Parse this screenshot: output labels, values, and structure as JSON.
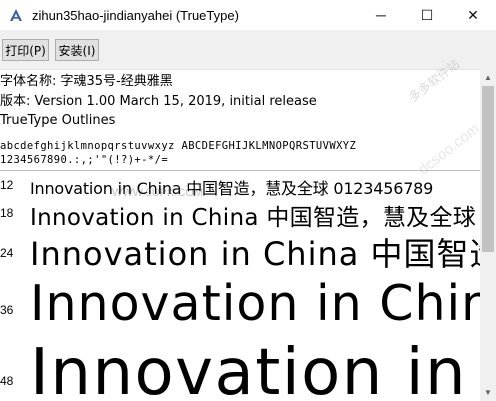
{
  "window": {
    "title": "zihun35hao-jindianyahei (TrueType)",
    "minimize_glyph": "─",
    "maximize_glyph": "☐",
    "close_glyph": "✕"
  },
  "toolbar": {
    "print_label": "打印(P)",
    "install_label": "安装(I)"
  },
  "font_info": {
    "name_line": "字体名称: 字魂35号-经典雅黑",
    "version_line": "版本: Version 1.00 March 15, 2019, initial release",
    "outline_line": "TrueType Outlines"
  },
  "charset": {
    "line1": "abcdefghijklmnopqrstuvwxyz ABCDEFGHIJKLMNOPQRSTUVWXYZ",
    "line2": "1234567890.:,;'\"(!?)+-*/="
  },
  "samples": [
    {
      "size": "12",
      "text": "Innovation in China 中国智造，慧及全球 0123456789"
    },
    {
      "size": "18",
      "text": "Innovation in China 中国智造，慧及全球"
    },
    {
      "size": "24",
      "text": "Innovation in China 中国智造"
    },
    {
      "size": "36",
      "text": "Innovation in China"
    },
    {
      "size": "48",
      "text": "Innovation in"
    }
  ],
  "watermarks": {
    "url": "WWW.9UPK.COM",
    "site": "多多软件站",
    "domain": "dcsoo.com"
  }
}
